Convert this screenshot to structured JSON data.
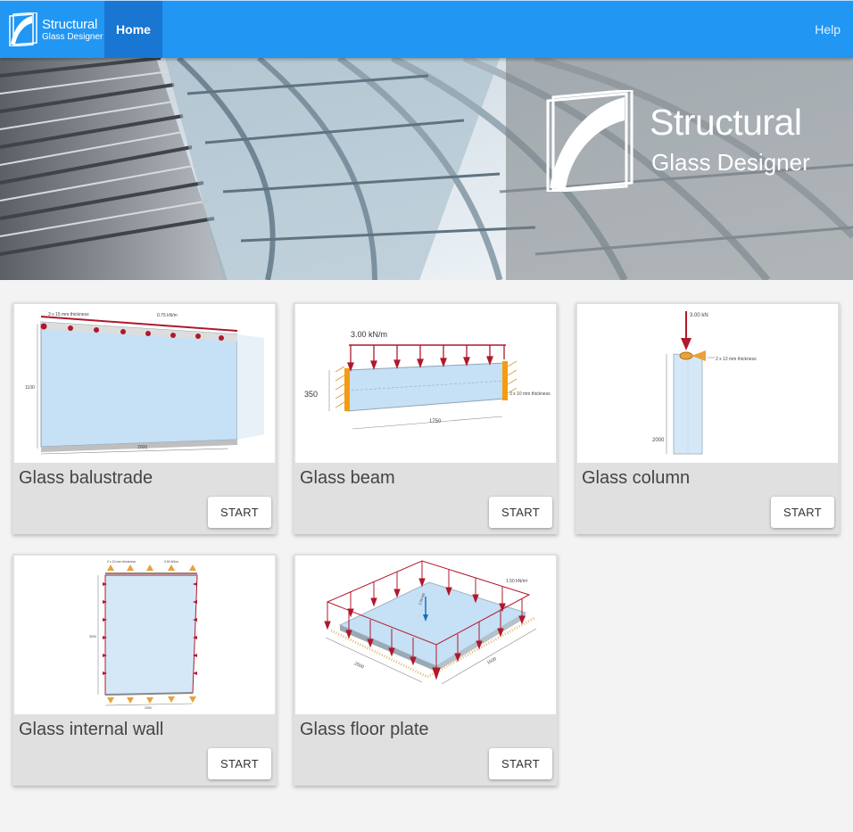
{
  "navbar": {
    "brand_line1": "Structural",
    "brand_line2": "Glass Designer",
    "home_label": "Home",
    "help_label": "Help",
    "color": "#2196f3",
    "active_color": "#1976d2"
  },
  "hero": {
    "title_line1": "Structural",
    "title_line2": "Glass Designer"
  },
  "cards": [
    {
      "title": "Glass balustrade",
      "button": "START",
      "icon": "glass-balustrade-drawing",
      "labels": {
        "thickness": "3 x 15 mm thickness",
        "load": "0.75 kN/m",
        "height": "1100",
        "width": "2000"
      }
    },
    {
      "title": "Glass beam",
      "button": "START",
      "icon": "glass-beam-drawing",
      "labels": {
        "load": "3.00 kN/m",
        "height": "350",
        "span": "1750",
        "thickness": "3 x 10 mm thickness"
      }
    },
    {
      "title": "Glass column",
      "button": "START",
      "icon": "glass-column-drawing",
      "labels": {
        "load": "3.00 kN",
        "thickness": "2 x 12 mm thickness",
        "height": "2000"
      }
    },
    {
      "title": "Glass internal wall",
      "button": "START",
      "icon": "glass-internal-wall-drawing",
      "labels": {
        "thickness": "2 x 10 mm thickness",
        "load": "0.50 kN/m",
        "height": "3000",
        "width": "2000"
      }
    },
    {
      "title": "Glass floor plate",
      "button": "START",
      "icon": "glass-floor-plate-drawing",
      "labels": {
        "load": "1.50 kN/m²",
        "point": "2.00 kN",
        "width": "2500",
        "depth": "1500"
      }
    }
  ]
}
